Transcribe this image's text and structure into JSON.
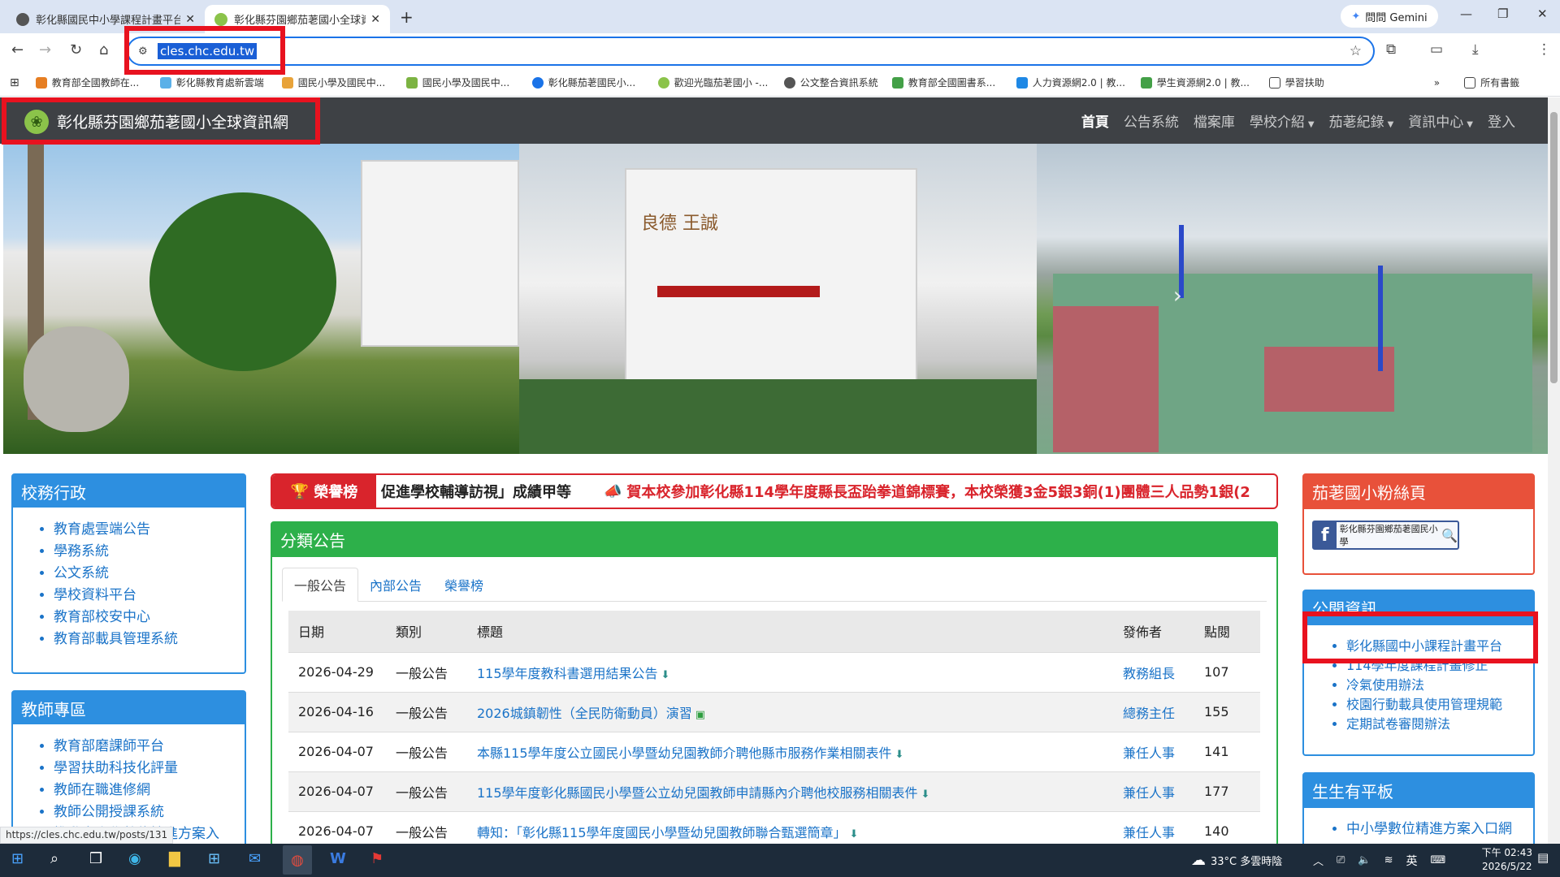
{
  "browser": {
    "tabs": [
      {
        "title": "彰化縣國民中小學課程計畫平台",
        "active": false
      },
      {
        "title": "彰化縣芬園鄉茄荖國小全球資訊",
        "active": true
      }
    ],
    "gemini_label": "問問 Gemini",
    "url": "cles.chc.edu.tw",
    "bookmarks": [
      "教育部全國教師在...",
      "彰化縣教育處新雲端",
      "國民小學及國民中...",
      "國民小學及國民中...",
      "彰化縣茄荖國民小...",
      "歡迎光臨茄荖國小 -...",
      "公文整合資訊系統",
      "教育部全國圖書系...",
      "人力資源網2.0 | 教...",
      "學生資源網2.0 | 教...",
      "學習扶助"
    ],
    "all_bookmarks": "所有書籤",
    "status_url": "https://cles.chc.edu.tw/posts/131"
  },
  "site": {
    "title": "彰化縣芬園鄉茄荖國小全球資訊網",
    "nav": [
      {
        "label": "首頁",
        "active": true,
        "dropdown": false
      },
      {
        "label": "公告系統",
        "active": false,
        "dropdown": false
      },
      {
        "label": "檔案庫",
        "active": false,
        "dropdown": false
      },
      {
        "label": "學校介紹",
        "active": false,
        "dropdown": true
      },
      {
        "label": "茄荖紀錄",
        "active": false,
        "dropdown": true
      },
      {
        "label": "資訊中心",
        "active": false,
        "dropdown": true
      },
      {
        "label": "登入",
        "active": false,
        "dropdown": false
      }
    ],
    "building_sign": "良德 王誠"
  },
  "left": {
    "admin": {
      "title": "校務行政",
      "items": [
        "教育處雲端公告",
        "學務系統",
        "公文系統",
        "學校資料平台",
        "教育部校安中心",
        "教育部載具管理系統"
      ]
    },
    "teacher": {
      "title": "教師專區",
      "items": [
        "教育部磨課師平台",
        "學習扶助科技化評量",
        "教師在職進修網",
        "教師公開授課系統",
        "推動中小學數位精進方案入"
      ]
    }
  },
  "ticker": {
    "label": "榮譽榜",
    "text1": "促進學校輔導訪視」成績甲等",
    "text2": "賀本校參加彰化縣114學年度縣長盃跆拳道錦標賽，本校榮獲3金5銀3銅(1)團體三人品勢1銀(2"
  },
  "announcements": {
    "title": "分類公告",
    "tabs": [
      "一般公告",
      "內部公告",
      "榮譽榜"
    ],
    "headers": [
      "日期",
      "類別",
      "標題",
      "發佈者",
      "點閱"
    ],
    "rows": [
      {
        "date": "2026-04-29",
        "cat": "一般公告",
        "title": "115學年度教科書選用結果公告",
        "icon": "download-icon",
        "author": "教務組長",
        "views": "107"
      },
      {
        "date": "2026-04-16",
        "cat": "一般公告",
        "title": "2026城鎮韌性（全民防衛動員）演習",
        "icon": "image-icon",
        "author": "總務主任",
        "views": "155"
      },
      {
        "date": "2026-04-07",
        "cat": "一般公告",
        "title": "本縣115學年度公立國民小學暨幼兒園教師介聘他縣市服務作業相關表件",
        "icon": "download-icon",
        "author": "兼任人事",
        "views": "141"
      },
      {
        "date": "2026-04-07",
        "cat": "一般公告",
        "title": "115學年度彰化縣國民小學暨公立幼兒園教師申請縣內介聘他校服務相關表件",
        "icon": "download-icon",
        "author": "兼任人事",
        "views": "177"
      },
      {
        "date": "2026-04-07",
        "cat": "一般公告",
        "title": "轉知：「彰化縣115學年度國民小學暨幼兒園教師聯合甄選簡章」",
        "icon": "download-icon",
        "author": "兼任人事",
        "views": "140"
      }
    ]
  },
  "right": {
    "fans": {
      "title": "茄荖國小粉絲頁",
      "fb_text": "彰化縣芬園鄉茄荖國民小學",
      "color": "#e8513a"
    },
    "public": {
      "title": "公開資訊",
      "items": [
        "彰化縣國中小課程計畫平台",
        "114學年度課程計畫修正",
        "冷氣使用辦法",
        "校園行動載具使用管理規範",
        "定期試卷審閱辦法"
      ],
      "color": "#2d8fe0"
    },
    "tablet": {
      "title": "生生有平板",
      "items": [
        "中小學數位精進方案入口網"
      ],
      "color": "#2d8fe0"
    }
  },
  "taskbar": {
    "weather": "33°C  多雲時陰",
    "ime": "英",
    "time": "下午 02:43",
    "date": "2026/5/22"
  },
  "colors": {
    "highlight": "#e8121f",
    "nav_bg": "#3e4145",
    "admin": "#2d8fe0",
    "announce": "#2db04a",
    "ticker": "#d9242c"
  }
}
